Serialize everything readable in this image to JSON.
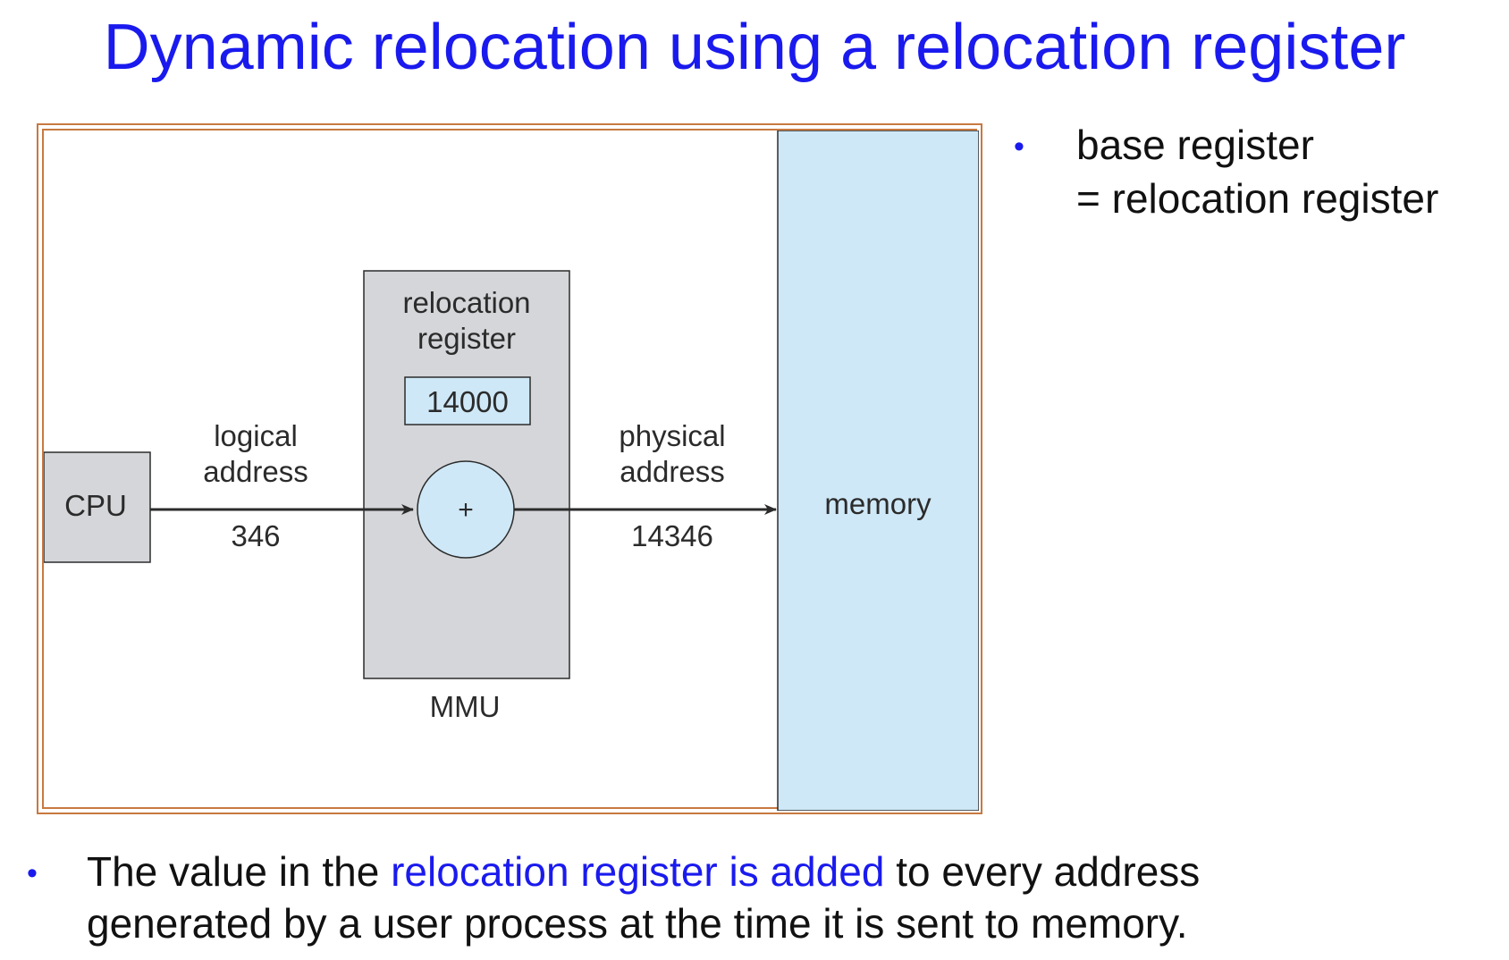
{
  "title": "Dynamic relocation using a relocation register",
  "diagram": {
    "cpu_label": "CPU",
    "logical_address_label_line1": "logical",
    "logical_address_label_line2": "address",
    "logical_address_value": "346",
    "relocation_register_label_line1": "relocation",
    "relocation_register_label_line2": "register",
    "relocation_register_value": "14000",
    "adder_symbol": "+",
    "mmu_label": "MMU",
    "physical_address_label_line1": "physical",
    "physical_address_label_line2": "address",
    "physical_address_value": "14346",
    "memory_label": "memory",
    "colors": {
      "frame": "#c87941",
      "register_fill": "#d4d6d9",
      "value_fill": "#cfe8f7",
      "memory_fill": "#cfe8f7"
    }
  },
  "side_note": {
    "bullet": "•",
    "line1": "base register",
    "line2": "= relocation register"
  },
  "bottom_note": {
    "bullet": "•",
    "text_before": "The value in the ",
    "text_highlight": "relocation register is added",
    "text_after": " to every address",
    "line2": "generated by a user process at the time it is sent to memory."
  },
  "colors": {
    "title": "#1a1aee",
    "highlight": "#1a1aee",
    "bullet": "#1a1aee"
  }
}
